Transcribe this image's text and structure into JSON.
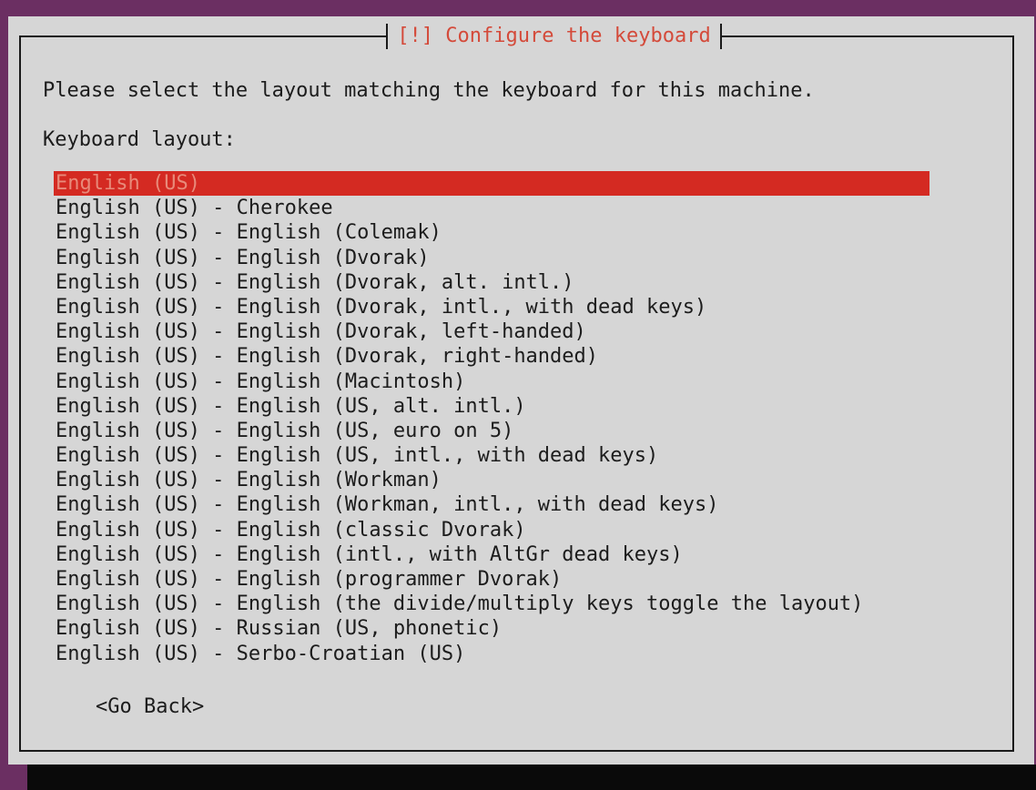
{
  "dialog": {
    "title": "[!] Configure the keyboard",
    "prompt": "Please select the layout matching the keyboard for this machine.",
    "list_label": "Keyboard layout:",
    "selected_index": 0,
    "items": [
      "English (US)",
      "English (US) - Cherokee",
      "English (US) - English (Colemak)",
      "English (US) - English (Dvorak)",
      "English (US) - English (Dvorak, alt. intl.)",
      "English (US) - English (Dvorak, intl., with dead keys)",
      "English (US) - English (Dvorak, left-handed)",
      "English (US) - English (Dvorak, right-handed)",
      "English (US) - English (Macintosh)",
      "English (US) - English (US, alt. intl.)",
      "English (US) - English (US, euro on 5)",
      "English (US) - English (US, intl., with dead keys)",
      "English (US) - English (Workman)",
      "English (US) - English (Workman, intl., with dead keys)",
      "English (US) - English (classic Dvorak)",
      "English (US) - English (intl., with AltGr dead keys)",
      "English (US) - English (programmer Dvorak)",
      "English (US) - English (the divide/multiply keys toggle the layout)",
      "English (US) - Russian (US, phonetic)",
      "English (US) - Serbo-Croatian (US)"
    ],
    "back_button": "<Go Back>"
  },
  "colors": {
    "background": "#6b2f62",
    "dialog": "#d6d6d6",
    "title": "#d44a3a",
    "selection": "#d42a22",
    "text": "#1c1c1c"
  }
}
